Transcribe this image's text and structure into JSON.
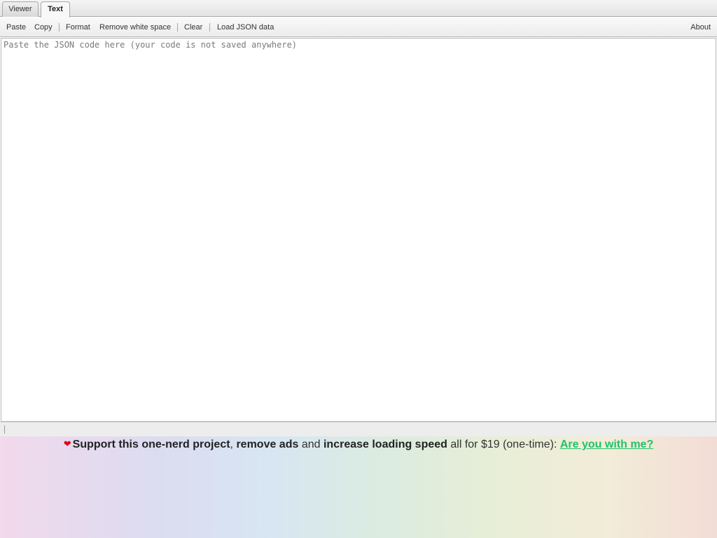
{
  "tabs": {
    "viewer_label": "Viewer",
    "text_label": "Text",
    "active": "Text"
  },
  "toolbar": {
    "paste_label": "Paste",
    "copy_label": "Copy",
    "format_label": "Format",
    "remove_whitespace_label": "Remove white space",
    "clear_label": "Clear",
    "load_json_label": "Load JSON data",
    "about_label": "About"
  },
  "editor": {
    "value": "",
    "placeholder": "Paste the JSON code here (your code is not saved anywhere)"
  },
  "promo": {
    "icon": "heart-icon",
    "part1": "Support this one-nerd project",
    "sep1": ", ",
    "part2": "remove ads",
    "sep2": " and ",
    "part3": "increase loading speed",
    "part4": " all for $19 (one-time): ",
    "link_label": "Are you with me?",
    "colors": {
      "heart": "#e0001a",
      "link": "#1fc26a"
    }
  }
}
